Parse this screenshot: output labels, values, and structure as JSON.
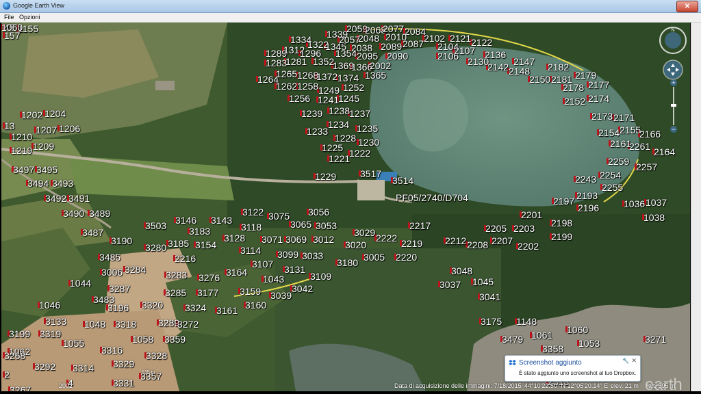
{
  "window": {
    "title": "Google Earth View",
    "close": "✕"
  },
  "menu": {
    "file": "File",
    "options": "Opzioni"
  },
  "labels": [
    "45",
    "1155",
    "157",
    "1339",
    "2059",
    "2068",
    "2077",
    "2084",
    "1334",
    "1322",
    "1345",
    "2057",
    "2048",
    "2010",
    "2089",
    "2087",
    "2102",
    "2121",
    "2104",
    "2122",
    "2107",
    "1289",
    "1312",
    "1296",
    "2038",
    "1354",
    "2095",
    "2090",
    "2106",
    "2136",
    "2130",
    "2147",
    "2142",
    "2148",
    "1283",
    "1281",
    "1352",
    "1369",
    "1366",
    "2002",
    "2182",
    "2179",
    "1264",
    "1265",
    "1268",
    "1372",
    "1374",
    "1365",
    "2150",
    "2181",
    "2177",
    "2178",
    "1262",
    "1258",
    "1249",
    "1252",
    "2152",
    "2174",
    "1256",
    "1241",
    "1245",
    "1202",
    "1204",
    "1239",
    "1238",
    "1237",
    "2173",
    "2171",
    "13",
    "1207",
    "1206",
    "1234",
    "1233",
    "1235",
    "2154",
    "2155",
    "2166",
    "1210",
    "1209",
    "1228",
    "1230",
    "2161",
    "2261",
    "2164",
    "1219",
    "1225",
    "1221",
    "1222",
    "3497",
    "3495",
    "2259",
    "2257",
    "3517",
    "1229",
    "3514",
    "2254",
    "2243",
    "2255",
    "3494",
    "3493",
    "3492",
    "3491",
    "2197",
    "2193",
    "1036",
    "1037",
    "2196",
    "3490",
    "3489",
    "3122",
    "3056",
    "3146",
    "3143",
    "3075",
    "3503",
    "3183",
    "3118",
    "3065",
    "3053",
    "2217",
    "1038",
    "2201",
    "2198",
    "2205",
    "2203",
    "3487",
    "3128",
    "3071",
    "3069",
    "3012",
    "3029",
    "3190",
    "3185",
    "3154",
    "3020",
    "2222",
    "2219",
    "2212",
    "2208",
    "2207",
    "2199",
    "3280",
    "3114",
    "2202",
    "3485",
    "3107",
    "3099",
    "3033",
    "3005",
    "2220",
    "2216",
    "3180",
    "3006",
    "3284",
    "3283",
    "3276",
    "3164",
    "3131",
    "3048",
    "1043",
    "3109",
    "3037",
    "1045",
    "1044",
    "3483",
    "3287",
    "3285",
    "3177",
    "3159",
    "3042",
    "3039",
    "3041",
    "1046",
    "3196",
    "3320",
    "3324",
    "3161",
    "3160",
    "3133",
    "3289",
    "3272",
    "3175",
    "1148",
    "1048",
    "3318",
    "3319",
    "3199",
    "3479",
    "1061",
    "1060",
    "1058",
    "3359",
    "3271",
    "1053",
    "1055",
    "3316",
    "3328",
    "3358",
    "1062",
    "3292",
    "3314",
    "3329",
    "3357",
    "3268",
    "2",
    "4",
    "3331",
    "3267",
    "2313",
    "1060"
  ],
  "special_label": "PF05/2740/D704",
  "toast": {
    "title": "Screenshot aggiunto",
    "body": "È stato aggiunto uno screenshot al tuo Dropbox."
  },
  "status": {
    "year": "2002",
    "scale": "135 m",
    "acquisition": "Data di acquisizione delle immagini: 7/18/2015",
    "coords": "44°10'22.50\" N 12°05'20.14\" E",
    "elev": "elev. 21 m",
    "eye": "alt. 595 m"
  },
  "logo": "earth",
  "colors": {
    "pin": "#c0141c",
    "accent": "#1d4fa0"
  }
}
